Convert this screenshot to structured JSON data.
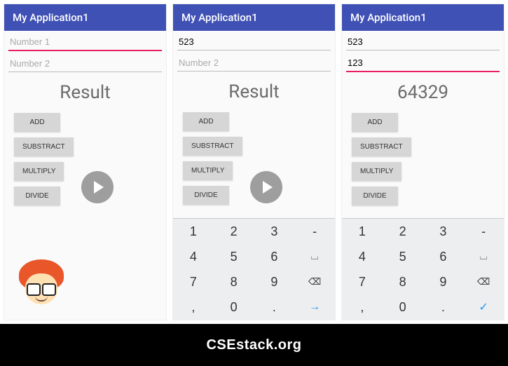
{
  "app_title": "My Application1",
  "placeholders": {
    "num1": "Number 1",
    "num2": "Number 2"
  },
  "buttons": {
    "add": "ADD",
    "sub": "SUBSTRACT",
    "mul": "MULTIPLY",
    "div": "DIVIDE"
  },
  "screens": [
    {
      "num1": "",
      "num2": "",
      "result": "Result",
      "num1_active": true,
      "num2_active": false,
      "show_keyboard": false,
      "show_play": true,
      "show_avatar": true
    },
    {
      "num1": "523",
      "num2": "",
      "result": "Result",
      "num1_active": false,
      "num2_active": false,
      "show_keyboard": true,
      "show_play": true,
      "show_avatar": false
    },
    {
      "num1": "523",
      "num2": "123",
      "result": "64329",
      "num1_active": false,
      "num2_active": true,
      "show_keyboard": true,
      "show_play": false,
      "show_avatar": false
    }
  ],
  "keyboard": {
    "rows": [
      [
        "1",
        "2",
        "3",
        "-"
      ],
      [
        "4",
        "5",
        "6",
        "␣"
      ],
      [
        "7",
        "8",
        "9",
        "⌫"
      ],
      [
        ",",
        "0",
        ".",
        "↵"
      ]
    ]
  },
  "footer": "CSEstack.org"
}
